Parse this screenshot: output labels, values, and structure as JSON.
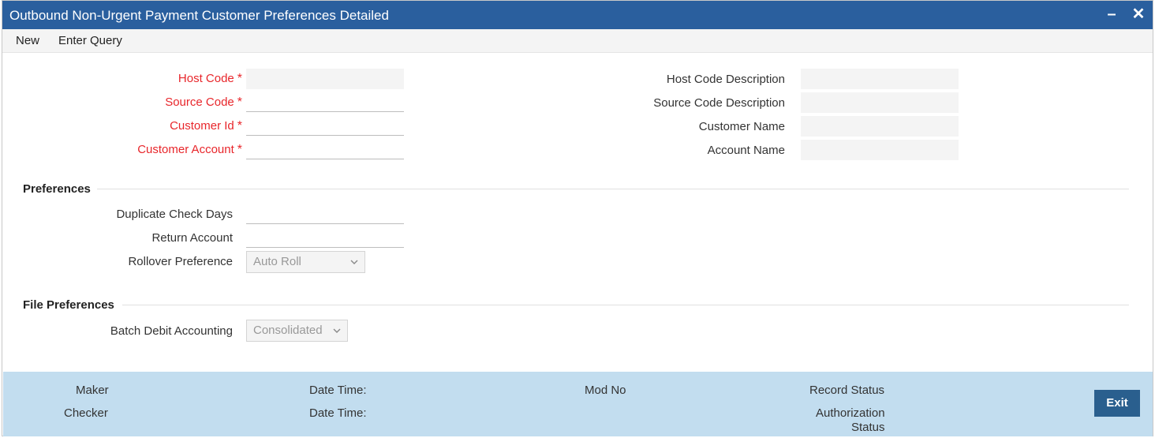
{
  "window": {
    "title": "Outbound Non-Urgent Payment Customer Preferences Detailed",
    "minimize_icon": "minimize-icon",
    "close_icon": "close-icon"
  },
  "menu": {
    "new_label": "New",
    "enter_query_label": "Enter Query"
  },
  "header_fields": {
    "host_code_label": "Host Code",
    "source_code_label": "Source Code",
    "customer_id_label": "Customer Id",
    "customer_account_label": "Customer Account",
    "required_marker": "*",
    "host_code_value": "",
    "source_code_value": "",
    "customer_id_value": "",
    "customer_account_value": "",
    "host_code_desc_label": "Host Code Description",
    "source_code_desc_label": "Source Code Description",
    "customer_name_label": "Customer Name",
    "account_name_label": "Account Name",
    "host_code_desc_value": "",
    "source_code_desc_value": "",
    "customer_name_value": "",
    "account_name_value": ""
  },
  "preferences": {
    "section_title": "Preferences",
    "duplicate_check_days_label": "Duplicate Check Days",
    "duplicate_check_days_value": "",
    "return_account_label": "Return Account",
    "return_account_value": "",
    "rollover_preference_label": "Rollover Preference",
    "rollover_preference_selected": "Auto Roll"
  },
  "file_preferences": {
    "section_title": "File Preferences",
    "batch_debit_accounting_label": "Batch Debit Accounting",
    "batch_debit_accounting_selected": "Consolidated"
  },
  "footer": {
    "maker_label": "Maker",
    "checker_label": "Checker",
    "date_time_label_1": "Date Time:",
    "date_time_label_2": "Date Time:",
    "mod_no_label": "Mod No",
    "record_status_label": "Record Status",
    "authorization_label": "Authorization",
    "status_label": "Status",
    "exit_label": "Exit"
  },
  "colors": {
    "titlebar": "#2a5f9e",
    "required_label": "#e8262b",
    "footer_bg": "#c2ddef",
    "exit_button": "#2a5f8e"
  }
}
